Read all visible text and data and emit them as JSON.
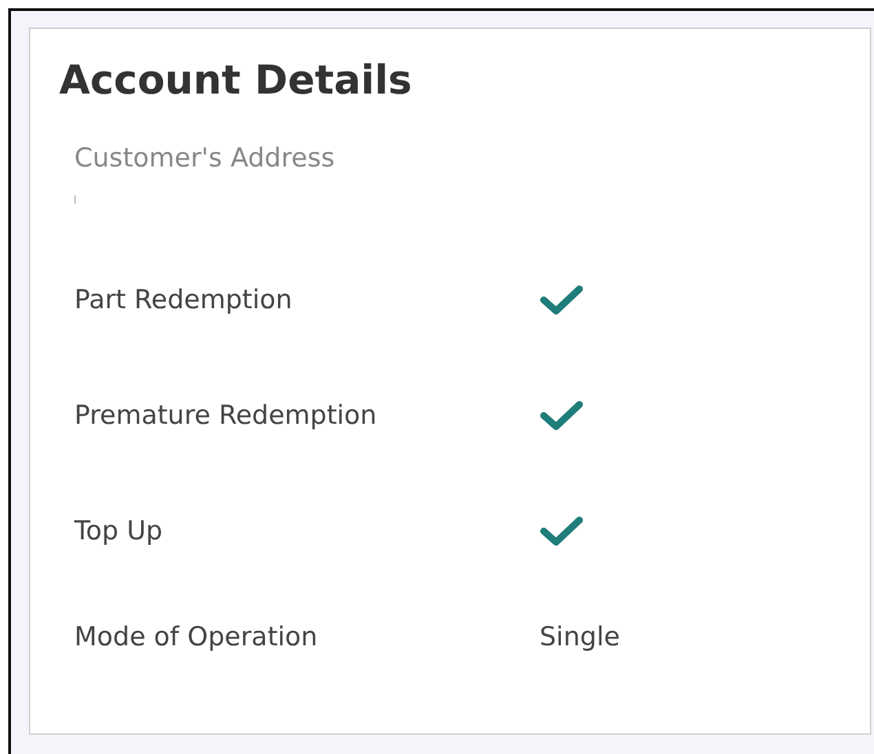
{
  "panel": {
    "title": "Account Details"
  },
  "address": {
    "label": "Customer's Address"
  },
  "rows": [
    {
      "kind": "check",
      "label": "Part Redemption",
      "checked": true
    },
    {
      "kind": "check",
      "label": "Premature Redemption",
      "checked": true
    },
    {
      "kind": "check",
      "label": "Top Up",
      "checked": true
    },
    {
      "kind": "text",
      "label": "Mode of Operation",
      "value": "Single"
    }
  ]
}
